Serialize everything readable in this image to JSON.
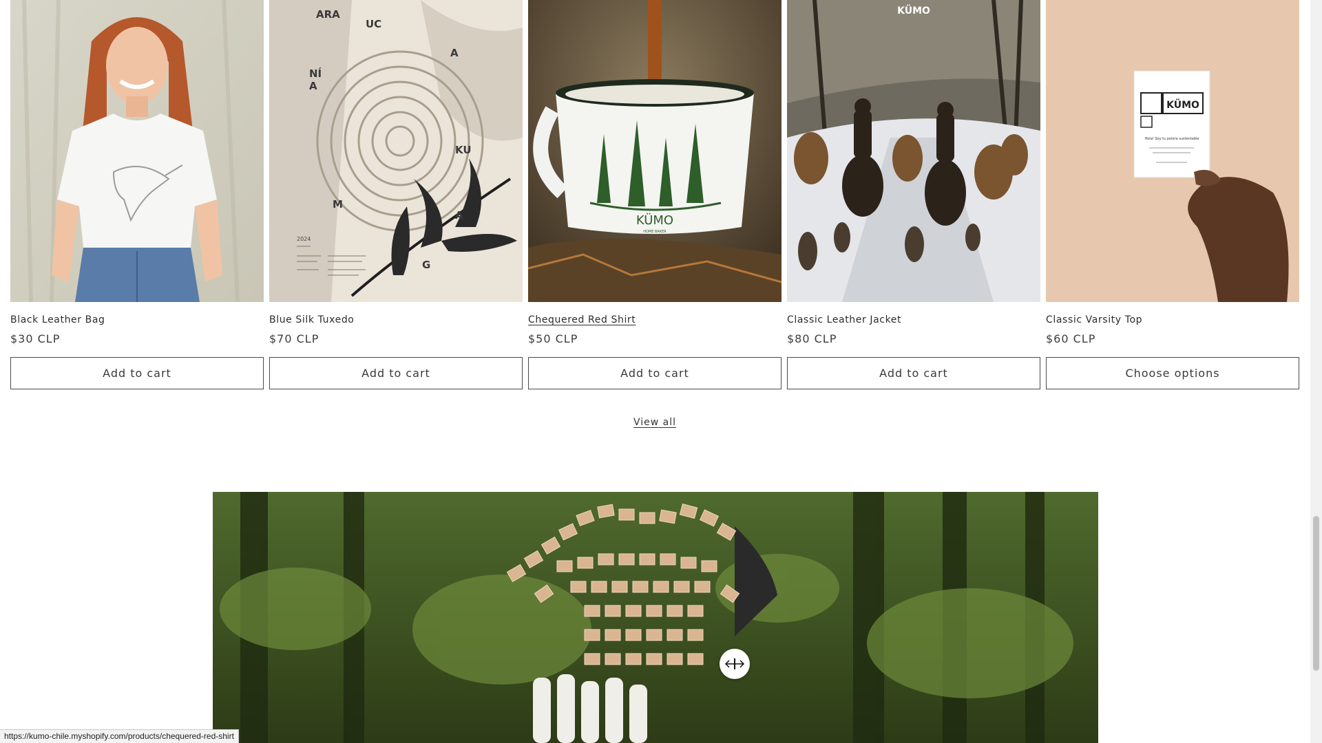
{
  "products": [
    {
      "title": "Black Leather Bag",
      "price": "$30 CLP",
      "button": "Add to cart",
      "image": "woman-white-tshirt-hummingbird"
    },
    {
      "title": "Blue Silk Tuxedo",
      "price": "$70 CLP",
      "button": "Add to cart",
      "image": "araucania-tree-ring-poster"
    },
    {
      "title": "Chequered Red Shirt",
      "price": "$50 CLP",
      "button": "Add to cart",
      "image": "enamel-mug-pine-trees"
    },
    {
      "title": "Classic Leather Jacket",
      "price": "$80 CLP",
      "button": "Add to cart",
      "image": "riders-cattle-snow"
    },
    {
      "title": "Classic Varsity Top",
      "price": "$60 CLP",
      "button": "Choose options",
      "image": "hand-holding-tag"
    }
  ],
  "poster_text": {
    "letters": [
      "ARA",
      "UC",
      "A",
      "NÍ",
      "A",
      "KU",
      "M",
      "G",
      "A"
    ],
    "year": "2024"
  },
  "mug_brand": "KÜMO",
  "mug_tagline": "HOME BAKER",
  "photo_brand": "KÜMO",
  "tag_text": {
    "brand": "KÜMO",
    "greeting": "Hola! Soy tu polera sustentable"
  },
  "view_all": "View all",
  "status_url": "https://kumo-chile.myshopify.com/products/chequered-red-shirt",
  "colors": {
    "button_border": "#4a4a4a",
    "mug_green": "#2e5e2a",
    "forest_green": "#3d4f1f"
  }
}
